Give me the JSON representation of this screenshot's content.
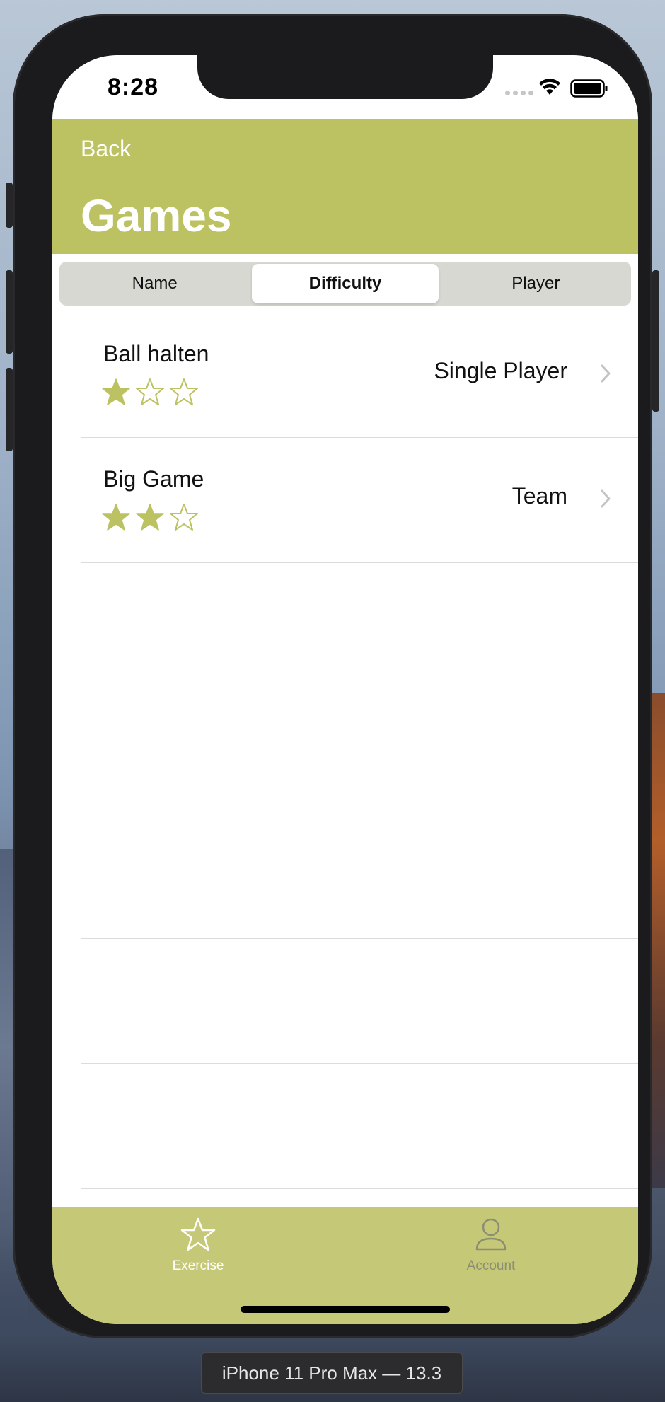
{
  "status_bar": {
    "time": "8:28"
  },
  "header": {
    "back_label": "Back",
    "title": "Games"
  },
  "segmented_control": {
    "segments": [
      "Name",
      "Difficulty",
      "Player"
    ],
    "selected": "Difficulty"
  },
  "games": [
    {
      "title": "Ball halten",
      "difficulty": 1,
      "max_difficulty": 3,
      "player": "Single Player"
    },
    {
      "title": "Big Game",
      "difficulty": 2,
      "max_difficulty": 3,
      "player": "Team"
    }
  ],
  "tab_bar": {
    "tabs": [
      {
        "label": "Exercise",
        "icon": "star-icon",
        "active": true
      },
      {
        "label": "Account",
        "icon": "person-icon",
        "active": false
      }
    ]
  },
  "simulator": {
    "device_label": "iPhone 11 Pro Max — 13.3"
  },
  "colors": {
    "accent": "#bcc262",
    "tab_bar": "#c5c977",
    "segment_bg": "#d7d8d2",
    "star_fill": "#bcc262"
  }
}
